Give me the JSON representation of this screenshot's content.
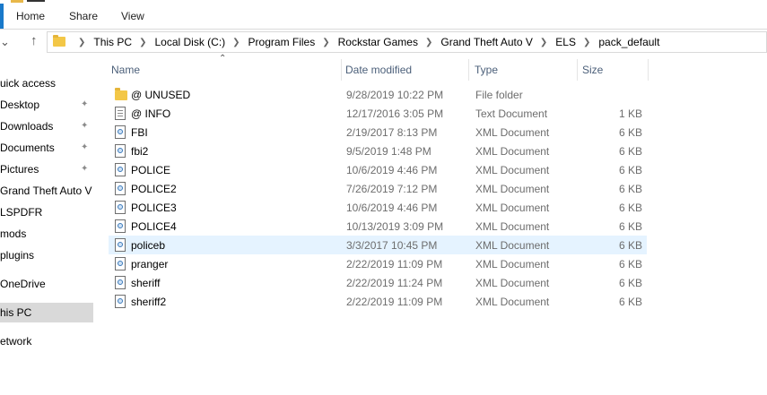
{
  "ribbon": {
    "tabs": [
      "Home",
      "Share",
      "View"
    ]
  },
  "address": {
    "crumbs": [
      "This PC",
      "Local Disk (C:)",
      "Program Files",
      "Rockstar Games",
      "Grand Theft Auto V",
      "ELS",
      "pack_default"
    ]
  },
  "nav": {
    "items": [
      {
        "label": "uick access",
        "pinned": false,
        "selected": false
      },
      {
        "label": "Desktop",
        "pinned": true,
        "selected": false
      },
      {
        "label": "Downloads",
        "pinned": true,
        "selected": false
      },
      {
        "label": "Documents",
        "pinned": true,
        "selected": false
      },
      {
        "label": "Pictures",
        "pinned": true,
        "selected": false
      },
      {
        "label": "Grand Theft Auto V",
        "pinned": false,
        "selected": false
      },
      {
        "label": "LSPDFR",
        "pinned": false,
        "selected": false
      },
      {
        "label": "mods",
        "pinned": false,
        "selected": false
      },
      {
        "label": "plugins",
        "pinned": false,
        "selected": false
      },
      {
        "label": "OneDrive",
        "pinned": false,
        "selected": false
      },
      {
        "label": "his PC",
        "pinned": false,
        "selected": true
      },
      {
        "label": "etwork",
        "pinned": false,
        "selected": false
      }
    ]
  },
  "columns": {
    "name": "Name",
    "date": "Date modified",
    "type": "Type",
    "size": "Size"
  },
  "files": [
    {
      "name": "@ UNUSED",
      "date": "9/28/2019 10:22 PM",
      "type": "File folder",
      "size": "",
      "icon": "folder-icon"
    },
    {
      "name": "@ INFO",
      "date": "12/17/2016 3:05 PM",
      "type": "Text Document",
      "size": "1 KB",
      "icon": "text-document-icon"
    },
    {
      "name": "FBI",
      "date": "2/19/2017 8:13 PM",
      "type": "XML Document",
      "size": "6 KB",
      "icon": "xml-document-icon"
    },
    {
      "name": "fbi2",
      "date": "9/5/2019 1:48 PM",
      "type": "XML Document",
      "size": "6 KB",
      "icon": "xml-document-icon"
    },
    {
      "name": "POLICE",
      "date": "10/6/2019 4:46 PM",
      "type": "XML Document",
      "size": "6 KB",
      "icon": "xml-document-icon"
    },
    {
      "name": "POLICE2",
      "date": "7/26/2019 7:12 PM",
      "type": "XML Document",
      "size": "6 KB",
      "icon": "xml-document-icon"
    },
    {
      "name": "POLICE3",
      "date": "10/6/2019 4:46 PM",
      "type": "XML Document",
      "size": "6 KB",
      "icon": "xml-document-icon"
    },
    {
      "name": "POLICE4",
      "date": "10/13/2019 3:09 PM",
      "type": "XML Document",
      "size": "6 KB",
      "icon": "xml-document-icon"
    },
    {
      "name": "policeb",
      "date": "3/3/2017 10:45 PM",
      "type": "XML Document",
      "size": "6 KB",
      "icon": "xml-document-icon"
    },
    {
      "name": "pranger",
      "date": "2/22/2019 11:09 PM",
      "type": "XML Document",
      "size": "6 KB",
      "icon": "xml-document-icon"
    },
    {
      "name": "sheriff",
      "date": "2/22/2019 11:24 PM",
      "type": "XML Document",
      "size": "6 KB",
      "icon": "xml-document-icon"
    },
    {
      "name": "sheriff2",
      "date": "2/22/2019 11:09 PM",
      "type": "XML Document",
      "size": "6 KB",
      "icon": "xml-document-icon"
    }
  ],
  "colors": {
    "accent": "#1979ca",
    "header_text": "#4c607a",
    "hover_row": "#e5f3ff",
    "nav_selected": "#d9d9d9",
    "folder": "#f3c747"
  }
}
